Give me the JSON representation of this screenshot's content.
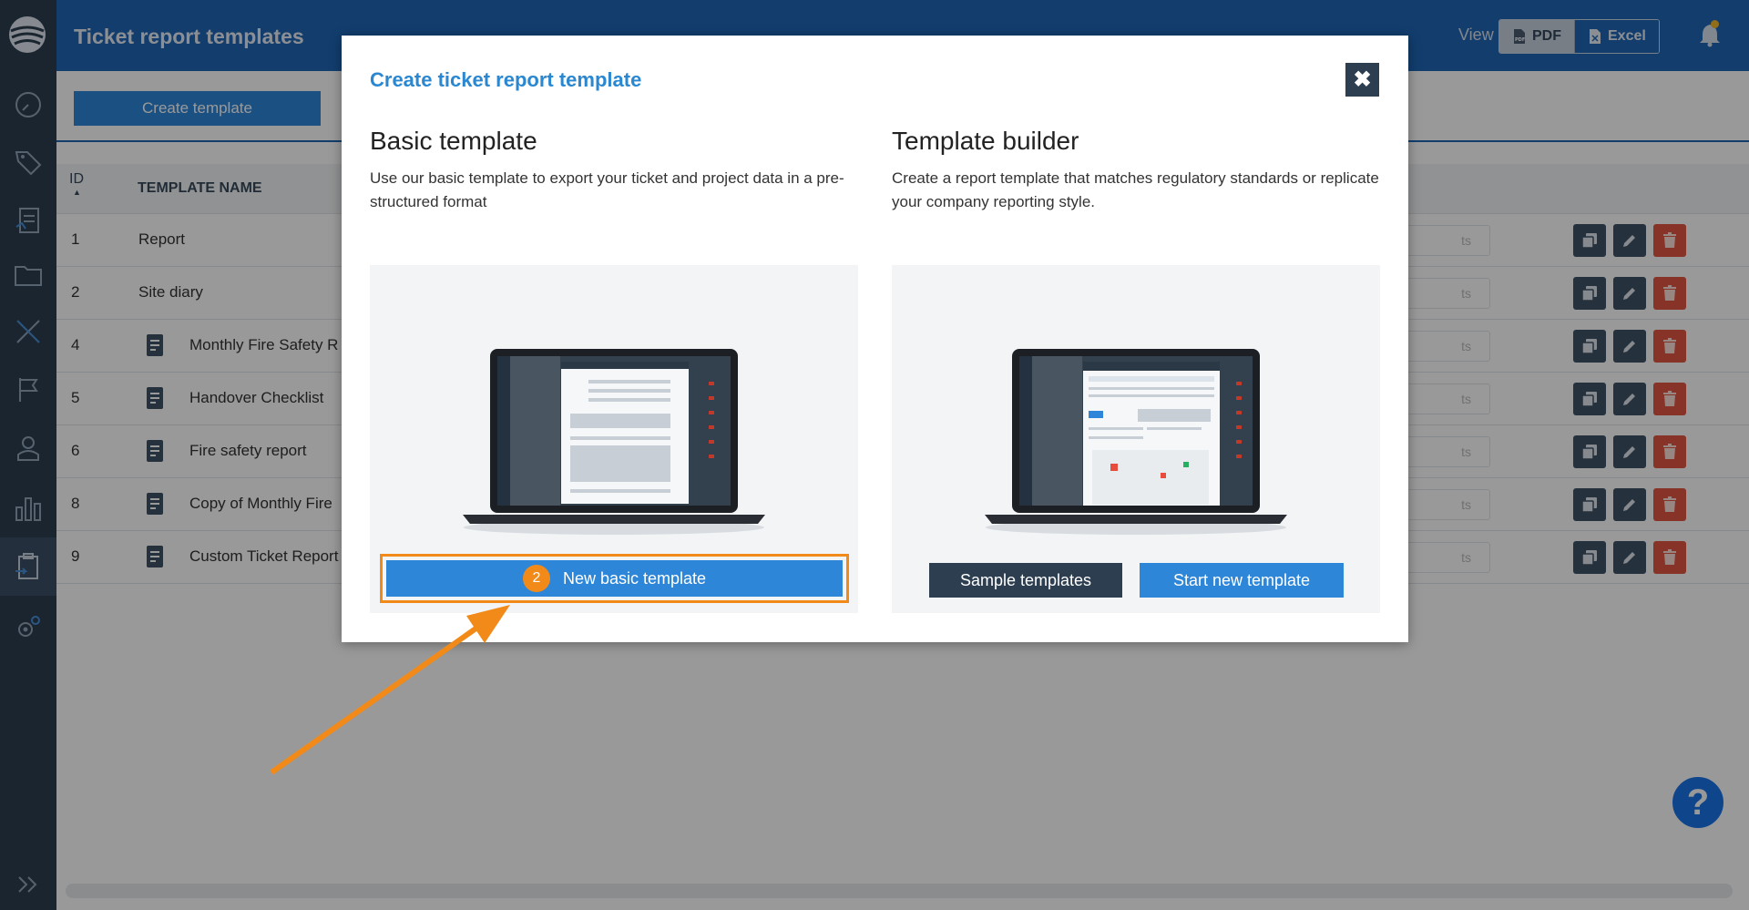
{
  "app": {
    "page_title": "Ticket report templates",
    "view_label": "View",
    "view_buttons": [
      {
        "label": "PDF",
        "icon": "pdf-icon"
      },
      {
        "label": "Excel",
        "icon": "excel-icon"
      }
    ],
    "create_template_label": "Create template"
  },
  "sidebar": {
    "items": [
      {
        "icon": "dashboard-gauge-icon"
      },
      {
        "icon": "tag-icon"
      },
      {
        "icon": "report-icon"
      },
      {
        "icon": "folder-icon"
      },
      {
        "icon": "ruler-pencil-icon"
      },
      {
        "icon": "flag-icon"
      },
      {
        "icon": "user-icon"
      },
      {
        "icon": "bar-chart-icon"
      },
      {
        "icon": "clipboard-icon"
      },
      {
        "icon": "settings-gear-icon"
      }
    ],
    "active_index": 8
  },
  "table": {
    "headers": {
      "id": "ID",
      "name": "TEMPLATE NAME"
    },
    "rows": [
      {
        "id": "1",
        "name": "Report",
        "icon": false
      },
      {
        "id": "2",
        "name": "Site diary",
        "icon": false
      },
      {
        "id": "4",
        "name": "Monthly Fire Safety R",
        "icon": true
      },
      {
        "id": "5",
        "name": "Handover Checklist",
        "icon": true
      },
      {
        "id": "6",
        "name": "Fire safety report",
        "icon": true
      },
      {
        "id": "8",
        "name": "Copy of Monthly Fire",
        "icon": true
      },
      {
        "id": "9",
        "name": "Custom Ticket Report",
        "icon": true
      }
    ],
    "ghost_text": "ts"
  },
  "modal": {
    "title": "Create ticket report template",
    "close_glyph": "✖",
    "basic": {
      "heading": "Basic template",
      "description": "Use our basic template to export your ticket and project data in a pre-structured format",
      "button_label": "New basic template",
      "step_number": "2"
    },
    "builder": {
      "heading": "Template builder",
      "description": "Create a report template that matches regulatory standards or replicate your company reporting style.",
      "sample_label": "Sample templates",
      "start_label": "Start new template"
    }
  },
  "help_glyph": "?",
  "colors": {
    "header_blue": "#1f66b6",
    "primary_button": "#2e86d9",
    "dark_button": "#2c3e50",
    "highlight_orange": "#f28a1a",
    "delete_red": "#e15641"
  }
}
